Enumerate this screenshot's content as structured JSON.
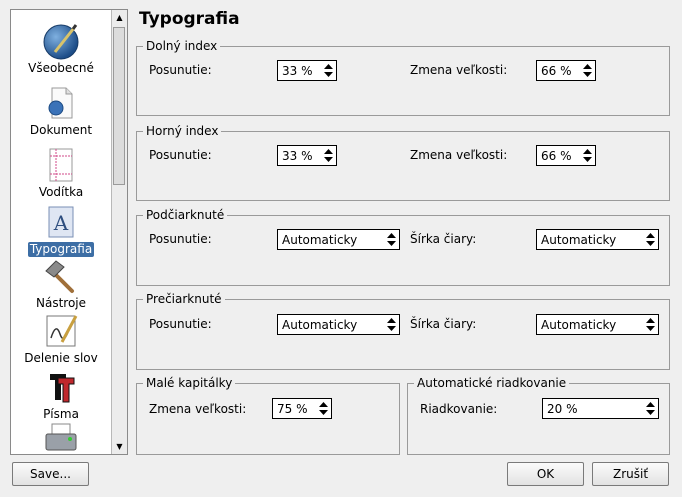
{
  "sidebar": {
    "items": [
      {
        "label": "Všeobecné",
        "icon": "globe-pen-icon"
      },
      {
        "label": "Dokument",
        "icon": "document-icon"
      },
      {
        "label": "Vodítka",
        "icon": "guides-icon"
      },
      {
        "label": "Typografia",
        "icon": "typography-icon",
        "selected": true
      },
      {
        "label": "Nástroje",
        "icon": "hammer-icon"
      },
      {
        "label": "Delenie slov",
        "icon": "hyphenation-icon"
      },
      {
        "label": "Písma",
        "icon": "fonts-icon"
      },
      {
        "label": "",
        "icon": "printer-icon"
      }
    ]
  },
  "page_title": "Typografia",
  "subscript": {
    "legend": "Dolný index",
    "displacement_label": "Posunutie:",
    "displacement_value": "33 %",
    "scaling_label": "Zmena veľkosti:",
    "scaling_value": "66 %"
  },
  "superscript": {
    "legend": "Horný index",
    "displacement_label": "Posunutie:",
    "displacement_value": "33 %",
    "scaling_label": "Zmena veľkosti:",
    "scaling_value": "66 %"
  },
  "underline": {
    "legend": "Podčiarknuté",
    "displacement_label": "Posunutie:",
    "displacement_value": "Automaticky",
    "width_label": "Šírka čiary:",
    "width_value": "Automaticky"
  },
  "strikethrough": {
    "legend": "Prečiarknuté",
    "displacement_label": "Posunutie:",
    "displacement_value": "Automaticky",
    "width_label": "Šírka čiary:",
    "width_value": "Automaticky"
  },
  "small_caps": {
    "legend": "Malé kapitálky",
    "scaling_label": "Zmena veľkosti:",
    "scaling_value": "75 %"
  },
  "auto_linespacing": {
    "legend": "Automatické riadkovanie",
    "linespacing_label": "Riadkovanie:",
    "linespacing_value": "20 %"
  },
  "buttons": {
    "save": "Save...",
    "ok": "OK",
    "cancel": "Zrušiť"
  },
  "colors": {
    "selection": "#3d6ea5",
    "background": "#efefef"
  }
}
